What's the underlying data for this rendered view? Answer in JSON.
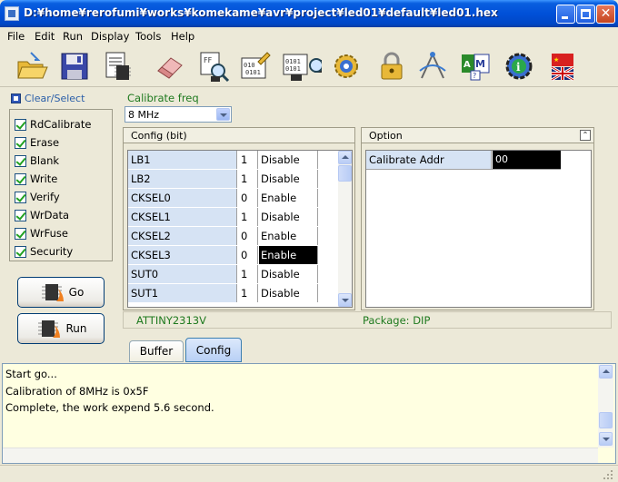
{
  "window": {
    "title": "D:¥home¥rerofumi¥works¥komekame¥avr¥project¥led01¥default¥led01.hex"
  },
  "menu": [
    "File",
    "Edit",
    "Run",
    "Display",
    "Tools",
    "Help"
  ],
  "toolbar": [
    "open-folder-icon",
    "save-disk-icon",
    "chip-document-icon",
    "eraser-icon",
    "blank-check-ff-icon",
    "write-pencil-icon",
    "read-binary-icon",
    "verify-magnifier-chip-icon",
    "settings-gear-icon",
    "lock-icon",
    "compass-tool-icon",
    "avr-help-icon",
    "info-gear-icon",
    "language-flags-icon"
  ],
  "left": {
    "clear_select": "Clear/Select",
    "checks": [
      "RdCalibrate",
      "Erase",
      "Blank",
      "Write",
      "Verify",
      "WrData",
      "WrFuse",
      "Security"
    ],
    "go_label": "Go",
    "run_label": "Run"
  },
  "calibrate": {
    "label": "Calibrate freq",
    "value": "8 MHz"
  },
  "config": {
    "header": "Config   (bit)",
    "rows": [
      {
        "name": "LB1",
        "bit": "1",
        "val": "Disable"
      },
      {
        "name": "LB2",
        "bit": "1",
        "val": "Disable"
      },
      {
        "name": "CKSEL0",
        "bit": "0",
        "val": "Enable"
      },
      {
        "name": "CKSEL1",
        "bit": "1",
        "val": "Disable"
      },
      {
        "name": "CKSEL2",
        "bit": "0",
        "val": "Enable"
      },
      {
        "name": "CKSEL3",
        "bit": "0",
        "val": "Enable"
      },
      {
        "name": "SUT0",
        "bit": "1",
        "val": "Disable"
      },
      {
        "name": "SUT1",
        "bit": "1",
        "val": "Disable"
      }
    ]
  },
  "option": {
    "header": "Option",
    "field": "Calibrate Addr",
    "value": "00"
  },
  "status": {
    "device": "ATTINY2313V",
    "package": "Package: DIP"
  },
  "tabs": [
    "Buffer",
    "Config"
  ],
  "log": [
    "Start go...",
    "Calibration of 8MHz is 0x5F",
    "Complete,  the work expend 5.6 second."
  ],
  "colors": {
    "title_blue": "#0050D8",
    "green_text": "#1F7A1F",
    "link_blue": "#2A5EA8",
    "log_bg": "#FFFFE1",
    "grid_name_bg": "#D6E3F4"
  }
}
